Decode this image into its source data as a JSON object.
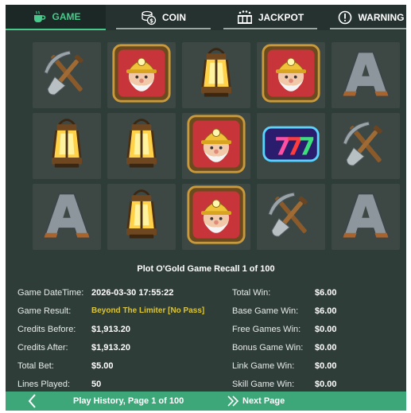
{
  "tabs": [
    {
      "label": "GAME",
      "icon": "coffee-cup-icon",
      "active": true
    },
    {
      "label": "COIN",
      "icon": "coin-stack-icon",
      "active": false
    },
    {
      "label": "JACKPOT",
      "icon": "jackpot-reel-icon",
      "active": false
    },
    {
      "label": "WARNING",
      "icon": "exclamation-circle-icon",
      "active": false
    }
  ],
  "reels": {
    "rows": [
      [
        "pickaxe-shovel",
        "gold-miner",
        "lantern",
        "gold-miner",
        "letter-a"
      ],
      [
        "lantern",
        "lantern",
        "gold-miner",
        "lucky-777",
        "pickaxe-shovel"
      ],
      [
        "letter-a",
        "lantern",
        "gold-miner",
        "pickaxe-shovel",
        "letter-a"
      ]
    ]
  },
  "recall": {
    "title": "Plot O'Gold Game Recall 1 of 100",
    "left": [
      {
        "label": "Game DateTime:",
        "value": "2026-03-30 17:55:22"
      },
      {
        "label": "Game Result:",
        "value": "Beyond The Limiter [No Pass]"
      },
      {
        "label": "Credits Before:",
        "value": "$1,913.20"
      },
      {
        "label": "Credits After:",
        "value": "$1,913.20"
      },
      {
        "label": "Total Bet:",
        "value": "$5.00"
      },
      {
        "label": "Lines Played:",
        "value": "50"
      }
    ],
    "right": [
      {
        "label": "Total Win:",
        "value": "$6.00"
      },
      {
        "label": "Base Game Win:",
        "value": "$6.00"
      },
      {
        "label": "Free Games Win:",
        "value": "$0.00"
      },
      {
        "label": "Bonus Game Win:",
        "value": "$0.00"
      },
      {
        "label": "Link Game Win:",
        "value": "$0.00"
      },
      {
        "label": "Skill Game Win:",
        "value": "$0.00"
      }
    ]
  },
  "footer": {
    "history": "Play History, Page 1 of 100",
    "next": "Next Page"
  },
  "colors": {
    "accent": "#48c98b",
    "footer": "#3ea77a",
    "panel": "#2f3d39",
    "result_highlight": "#d9c43a"
  }
}
